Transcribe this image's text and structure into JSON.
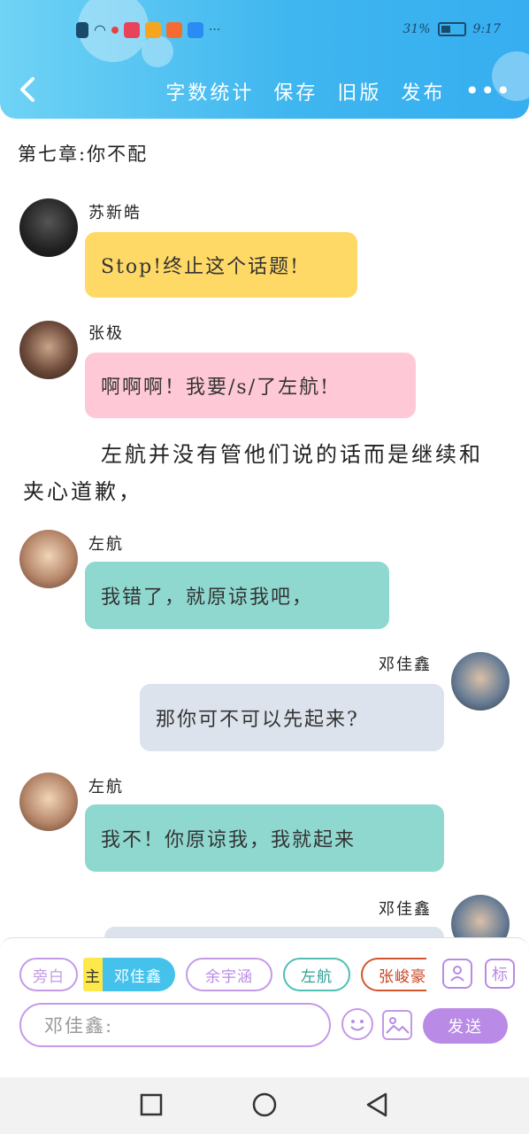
{
  "status_bar": {
    "battery": "31%",
    "time": "9:17",
    "more": "···"
  },
  "header": {
    "back_icon": "chevron-left-icon",
    "actions": [
      "字数统计",
      "保存",
      "旧版",
      "发布"
    ],
    "more_icon": "more-dots-icon"
  },
  "chapter_title": "第七章:你不配",
  "messages": [
    {
      "name": "苏新皓",
      "text": "Stop!终止这个话题!",
      "color": "#ffd966"
    },
    {
      "name": "张极",
      "text": "啊啊啊！我要/s/了左航!",
      "color": "#ffc8d6"
    },
    {
      "name": "左航",
      "text": "我错了，就原谅我吧，",
      "color": "#8fd8cf"
    },
    {
      "name": "邓佳鑫",
      "text": "那你可不可以先起来?",
      "color": "#dde3ec"
    },
    {
      "name": "左航",
      "text": "我不！你原谅我，我就起来",
      "color": "#8fd8cf"
    },
    {
      "name": "邓佳鑫",
      "text": "",
      "color": "#dde3ec"
    }
  ],
  "narration": "左航并没有管他们说的话而是继续和夹心道歉，",
  "role_bar": {
    "chips": [
      "旁白",
      "邓佳鑫",
      "余宇涵",
      "左航",
      "张峻豪"
    ],
    "main_badge": "主",
    "tools": {
      "avatar_tool": "person-card-icon",
      "mark_tool": "标"
    }
  },
  "composer": {
    "placeholder": "邓佳鑫:",
    "emoji_icon": "smiley-icon",
    "image_icon": "image-icon",
    "send_label": "发送"
  },
  "colors": {
    "accent": "#3fb6ef",
    "purple": "#b98be6"
  }
}
